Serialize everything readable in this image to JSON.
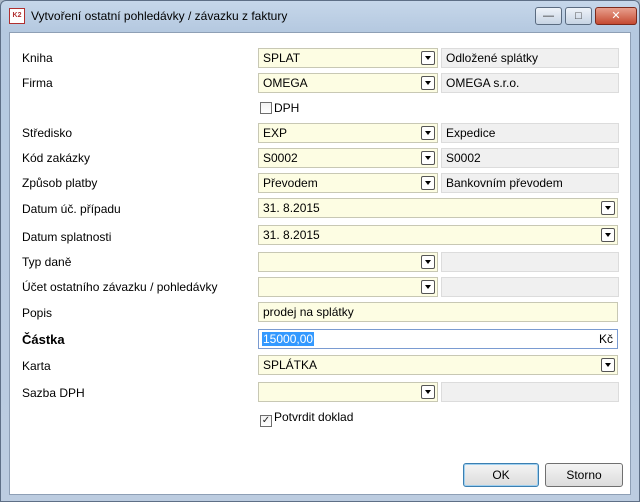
{
  "window": {
    "title": "Vytvoření ostatní pohledávky / závazku z faktury",
    "app_icon_text": "K2",
    "buttons": {
      "minimize": "—",
      "maximize": "□",
      "close": "✕"
    }
  },
  "form": {
    "kniha": {
      "label": "Kniha",
      "value": "SPLAT",
      "desc": "Odložené splátky"
    },
    "firma": {
      "label": "Firma",
      "value": "OMEGA",
      "desc": "OMEGA s.r.o."
    },
    "dph": {
      "label": "DPH",
      "checked": false
    },
    "stredisko": {
      "label": "Středisko",
      "value": "EXP",
      "desc": "Expedice"
    },
    "kod_zakazky": {
      "label": "Kód zakázky",
      "value": "S0002",
      "desc": "S0002"
    },
    "zpusob_platby": {
      "label": "Způsob platby",
      "value": "Převodem",
      "desc": "Bankovním převodem"
    },
    "datum_uc_pripadu": {
      "label": "Datum úč. případu",
      "value": "31. 8.2015"
    },
    "datum_splatnosti": {
      "label": "Datum splatnosti",
      "value": "31. 8.2015"
    },
    "typ_dane": {
      "label": "Typ daně",
      "value": "",
      "desc": ""
    },
    "ucet": {
      "label": "Účet ostatního závazku / pohledávky",
      "value": "",
      "desc": ""
    },
    "popis": {
      "label": "Popis",
      "value": "prodej na splátky"
    },
    "castka": {
      "label": "Částka",
      "value": "15000,00",
      "currency": "Kč"
    },
    "karta": {
      "label": "Karta",
      "value": "SPLÁTKA"
    },
    "sazba_dph": {
      "label": "Sazba DPH",
      "value": "",
      "desc": ""
    },
    "potvrdit": {
      "label": "Potvrdit doklad",
      "checked": true,
      "check_glyph": "✓"
    }
  },
  "actions": {
    "ok": "OK",
    "storno": "Storno"
  }
}
